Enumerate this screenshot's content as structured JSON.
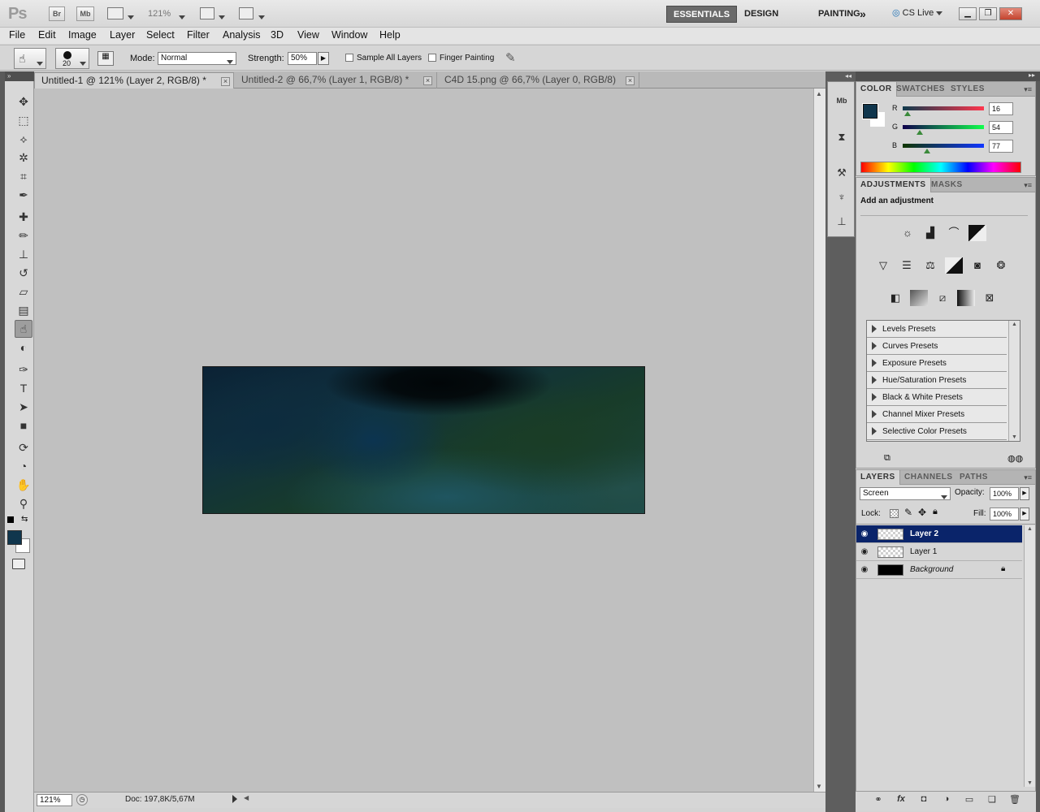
{
  "app": {
    "logo": "Ps",
    "bridge_button": "Br",
    "minibridge_button": "Mb",
    "zoom_value": "121%",
    "workspaces": [
      "ESSENTIALS",
      "DESIGN",
      "PAINTING"
    ],
    "workspace_more": "»",
    "cs_live": "CS Live"
  },
  "menu": [
    "File",
    "Edit",
    "Image",
    "Layer",
    "Select",
    "Filter",
    "Analysis",
    "3D",
    "View",
    "Window",
    "Help"
  ],
  "options": {
    "brush_size": "20",
    "mode_label": "Mode:",
    "mode_value": "Normal",
    "strength_label": "Strength:",
    "strength_value": "50%",
    "sample_all_layers": "Sample All Layers",
    "finger_painting": "Finger Painting"
  },
  "tabs": [
    {
      "label": "Untitled-1 @ 121% (Layer 2, RGB/8) *",
      "active": true
    },
    {
      "label": "Untitled-2 @ 66,7% (Layer 1, RGB/8) *",
      "active": false
    },
    {
      "label": "C4D 15.png @ 66,7% (Layer 0, RGB/8)",
      "active": false
    }
  ],
  "status": {
    "zoom": "121%",
    "doc": "Doc: 197,8K/5,67M"
  },
  "colors": {
    "foreground": "#10364d",
    "background": "#ffffff",
    "accent": "#0a246a"
  },
  "color_panel": {
    "tabs": [
      "COLOR",
      "SWATCHES",
      "STYLES"
    ],
    "channels": [
      {
        "label": "R",
        "value": "16"
      },
      {
        "label": "G",
        "value": "54"
      },
      {
        "label": "B",
        "value": "77"
      }
    ]
  },
  "adjustments": {
    "tabs": [
      "ADJUSTMENTS",
      "MASKS"
    ],
    "heading": "Add an adjustment",
    "presets": [
      "Levels Presets",
      "Curves Presets",
      "Exposure Presets",
      "Hue/Saturation Presets",
      "Black & White Presets",
      "Channel Mixer Presets",
      "Selective Color Presets"
    ]
  },
  "layers": {
    "tabs": [
      "LAYERS",
      "CHANNELS",
      "PATHS"
    ],
    "blend_mode": "Screen",
    "opacity_label": "Opacity:",
    "opacity_value": "100%",
    "lock_label": "Lock:",
    "fill_label": "Fill:",
    "fill_value": "100%",
    "items": [
      {
        "name": "Layer 2",
        "selected": true
      },
      {
        "name": "Layer 1",
        "selected": false
      },
      {
        "name": "Background",
        "selected": false
      }
    ]
  }
}
